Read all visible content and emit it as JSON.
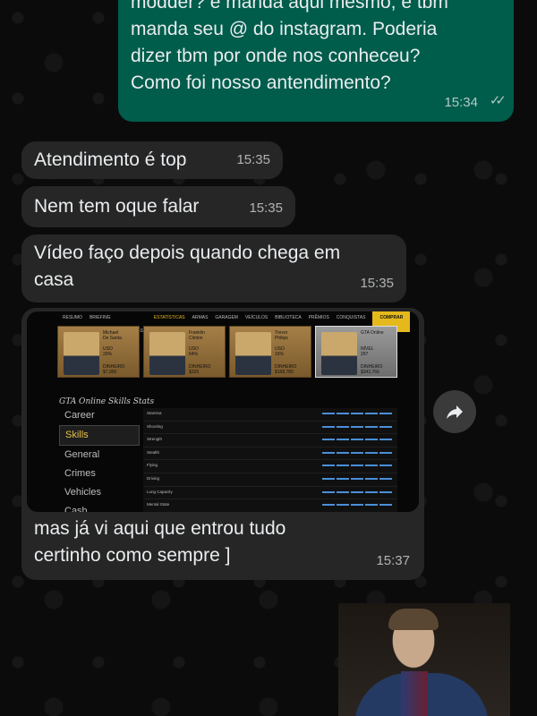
{
  "messages": {
    "outgoing_top": {
      "text": "modder? é manda aqui mesmo, e tbm\nmanda seu @ do instagram. Poderia\ndizer tbm por onde nos conheceu?\nComo foi nosso antendimento?",
      "time": "15:34",
      "ticks": "✓✓"
    },
    "incoming_1": {
      "text": "Atendimento é top",
      "time": "15:35"
    },
    "incoming_2": {
      "text": "Nem tem oque falar",
      "time": "15:35"
    },
    "incoming_3": {
      "text": "Vídeo faço depois quando chega em\ncasa",
      "time": "15:35"
    },
    "incoming_image": {
      "caption": "mas já vi aqui que entrou tudo\ncertinho como sempre ]",
      "time": "15:37"
    }
  },
  "game_screenshot": {
    "nav": [
      "RESUMO",
      "BRIEFING",
      "LISTA DE PROGRESSO",
      "ESTATÍSTICAS",
      "ARMAS",
      "GARAGEM",
      "VEÍCULOS",
      "BIBLIOTECA",
      "PRÊMIOS",
      "CONQUISTAS"
    ],
    "nav_active_index": 3,
    "nav_button": "COMPRAR",
    "characters": [
      {
        "name": "Michael\nDe Santa",
        "stats": "USO\n20%",
        "money": "DINHEIRO\n$7,900"
      },
      {
        "name": "Franklin\nClinton",
        "stats": "USO\n64%",
        "money": "DINHEIRO\n$326"
      },
      {
        "name": "Trevor\nPhilips",
        "stats": "USO\n16%",
        "money": "DINHEIRO\n$168,780"
      },
      {
        "name": "GTA Online",
        "stats": "NÍVEL\n297",
        "money": "DINHEIRO\n$342,766"
      }
    ],
    "stats_title": "GTA Online Skills Stats",
    "menu": [
      "Career",
      "Skills",
      "General",
      "Crimes",
      "Vehicles",
      "Cash"
    ],
    "menu_active_index": 1,
    "rows": [
      "Stamina",
      "Shooting",
      "Strength",
      "Stealth",
      "Flying",
      "Driving",
      "Lung Capacity",
      "Mental State"
    ]
  }
}
